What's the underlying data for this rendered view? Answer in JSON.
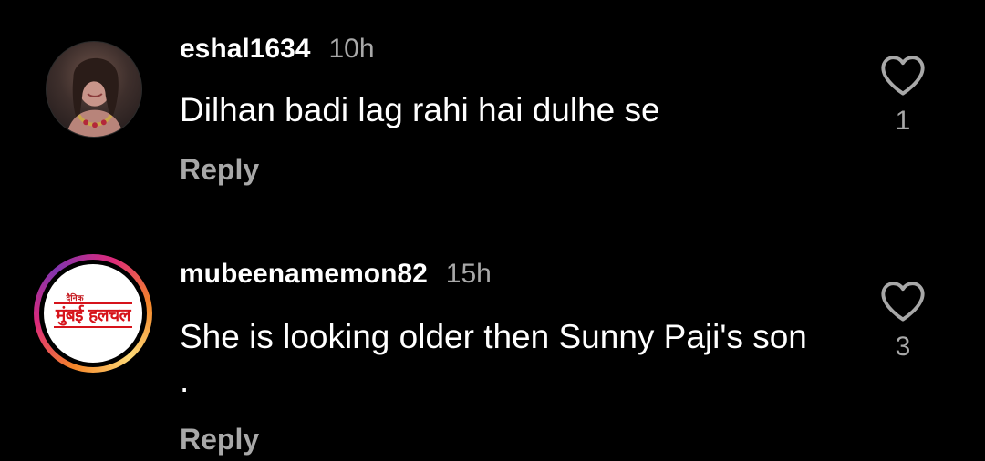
{
  "comments": [
    {
      "username": "eshal1634",
      "time": "10h",
      "text": "Dilhan badi lag rahi hai dulhe se",
      "reply_label": "Reply",
      "likes": "1",
      "avatar": "profile-photo"
    },
    {
      "username": "mubeenamemon82",
      "time": "15h",
      "text": "She is looking older then Sunny Paji's son .",
      "reply_label": "Reply",
      "likes": "3",
      "avatar": {
        "logo_small": "दैनिक",
        "logo_text": "मुंबई हलचल",
        "story_ring": true
      }
    }
  ],
  "colors": {
    "background": "#000000",
    "primary_text": "#ffffff",
    "secondary_text": "#a8a8a8",
    "logo_red": "#d6131b"
  },
  "icons": {
    "like": "heart-outline-icon"
  }
}
